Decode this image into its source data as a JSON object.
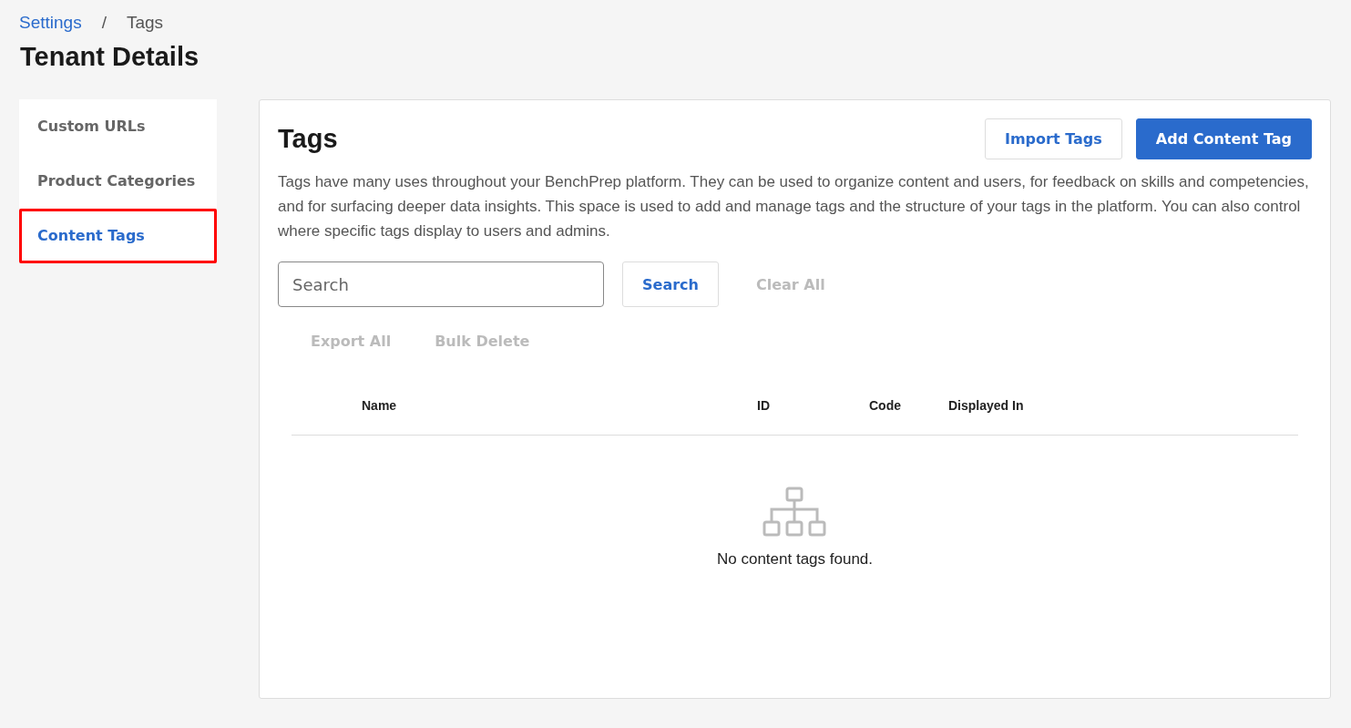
{
  "breadcrumb": [
    {
      "label": "Settings",
      "kind": "link"
    },
    {
      "label": "/",
      "kind": "separator"
    },
    {
      "label": "Tags",
      "kind": "current"
    }
  ],
  "page_title": "Tenant Details",
  "sidebar": {
    "items": [
      {
        "label": "Custom URLs",
        "selected": false,
        "highlighted": false
      },
      {
        "label": "Product Categories",
        "selected": false,
        "highlighted": false
      },
      {
        "label": "Content Tags",
        "selected": true,
        "highlighted": true
      }
    ]
  },
  "panel": {
    "title": "Tags",
    "buttons": [
      {
        "label": "Import Tags",
        "kind": "secondary"
      },
      {
        "label": "Add Content Tag",
        "kind": "primary"
      }
    ],
    "description": "Tags have many uses throughout your BenchPrep platform. They can be used to organize content and users, for feedback on skills and competencies, and for surfacing deeper data insights. This space is used to add and manage tags and the structure of your tags in the platform. You can also control where specific tags display to users and admins.",
    "search": {
      "placeholder": "Search",
      "button": "Search",
      "clear": {
        "label": "Clear All",
        "disabled": true
      }
    },
    "actions": [
      {
        "label": "Export All",
        "disabled": true
      },
      {
        "label": "Bulk Delete",
        "disabled": true
      }
    ],
    "table": {
      "columns": [
        "Name",
        "ID",
        "Code",
        "Displayed In"
      ],
      "empty_message": "No content tags found."
    }
  }
}
